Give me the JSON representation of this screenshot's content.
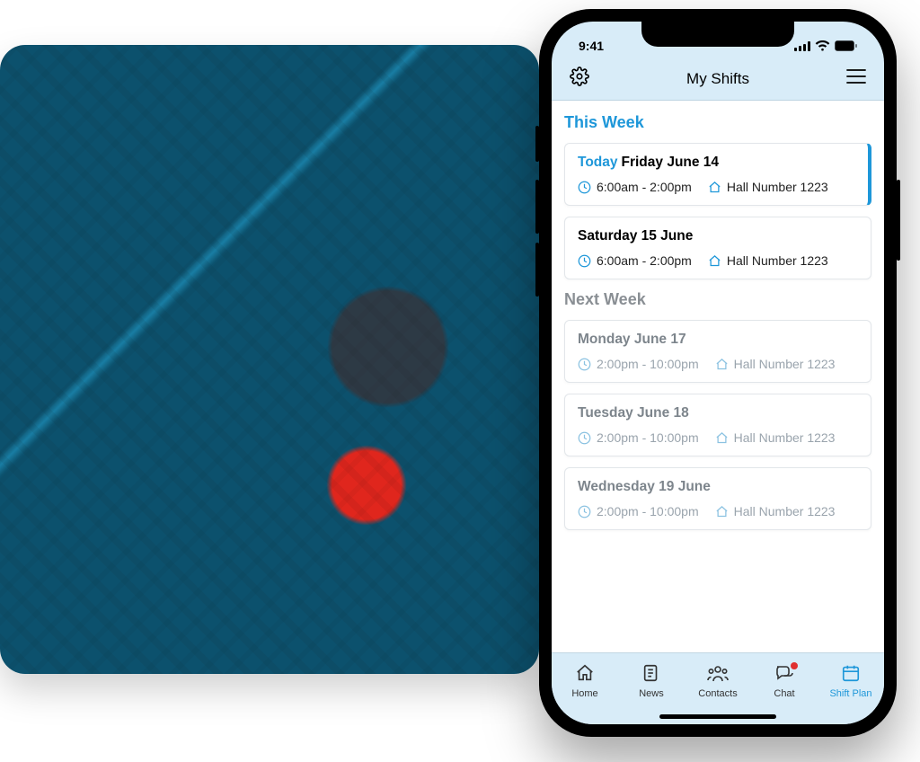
{
  "status": {
    "time": "9:41"
  },
  "header": {
    "title": "My Shifts"
  },
  "sections": {
    "this_week": {
      "title": "This Week",
      "shifts": [
        {
          "today_label": "Today",
          "date": "Friday June 14",
          "time": "6:00am - 2:00pm",
          "location": "Hall Number 1223"
        },
        {
          "today_label": "",
          "date": "Saturday 15 June",
          "time": "6:00am - 2:00pm",
          "location": "Hall Number 1223"
        }
      ]
    },
    "next_week": {
      "title": "Next Week",
      "shifts": [
        {
          "date": "Monday June 17",
          "time": "2:00pm - 10:00pm",
          "location": "Hall Number 1223"
        },
        {
          "date": "Tuesday June 18",
          "time": "2:00pm - 10:00pm",
          "location": "Hall Number 1223"
        },
        {
          "date": "Wednesday 19 June",
          "time": "2:00pm - 10:00pm",
          "location": "Hall Number 1223"
        }
      ]
    }
  },
  "tabs": {
    "home": "Home",
    "news": "News",
    "contacts": "Contacts",
    "chat": "Chat",
    "shift_plan": "Shift Plan"
  }
}
